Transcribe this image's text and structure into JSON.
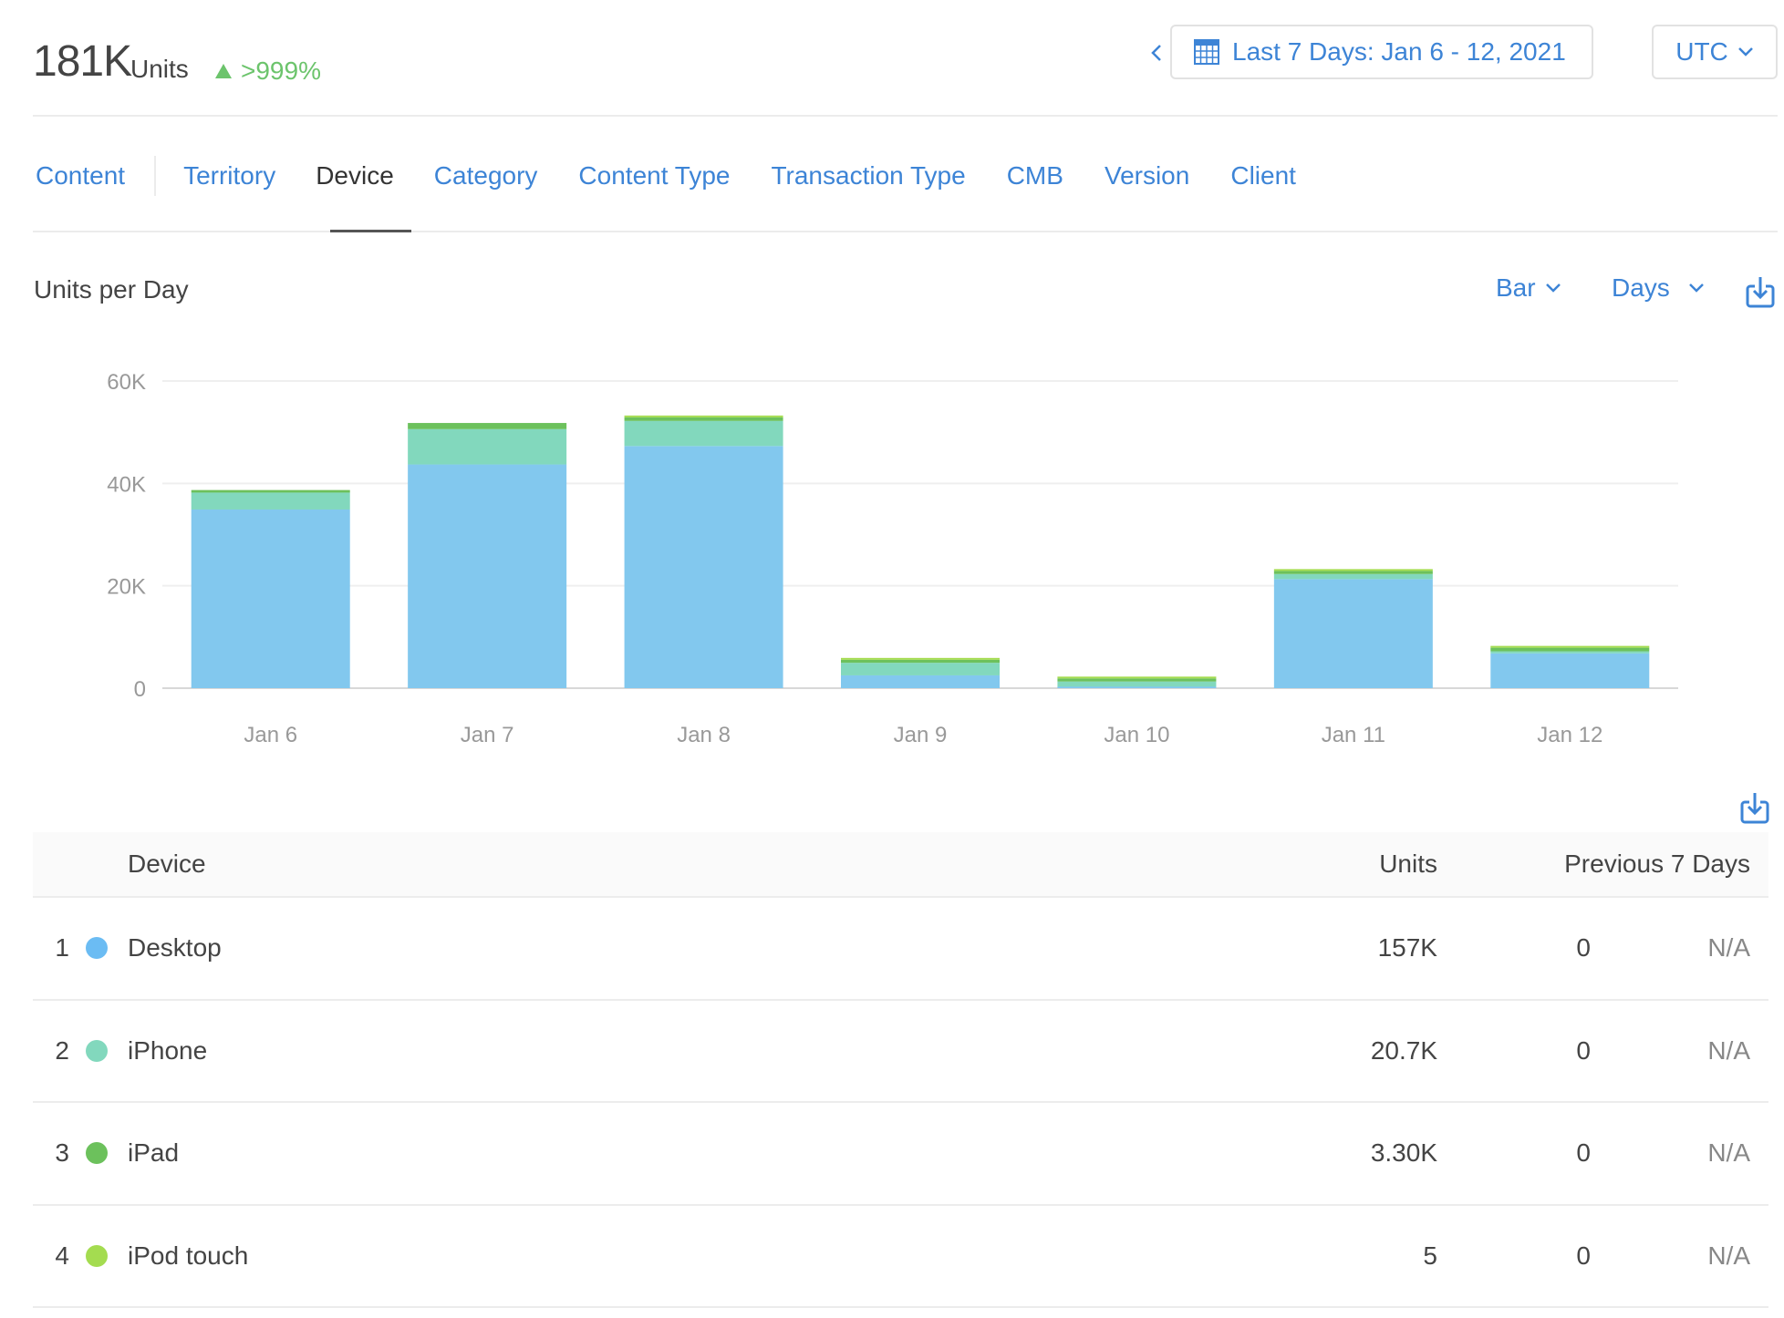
{
  "header": {
    "total_value": "181K",
    "total_unit": "Units",
    "change": ">999%",
    "change_direction": "up",
    "date_range": "Last 7 Days: Jan 6 - 12, 2021",
    "timezone": "UTC"
  },
  "tabs": [
    {
      "label": "Content",
      "active": false
    },
    {
      "label": "Territory",
      "active": false
    },
    {
      "label": "Device",
      "active": true
    },
    {
      "label": "Category",
      "active": false
    },
    {
      "label": "Content Type",
      "active": false
    },
    {
      "label": "Transaction Type",
      "active": false
    },
    {
      "label": "CMB",
      "active": false
    },
    {
      "label": "Version",
      "active": false
    },
    {
      "label": "Client",
      "active": false
    }
  ],
  "chart_controls": {
    "chart_type": "Bar",
    "period": "Days"
  },
  "colors": {
    "accent": "#3d84d6",
    "positive": "#6cc46c",
    "Desktop": "#82c8ee",
    "iPhone": "#82d8bd",
    "iPad": "#6cc15c",
    "iPod touch": "#a4dc50"
  },
  "chart_data": {
    "type": "bar",
    "stacked": true,
    "title": "Units per Day",
    "xlabel": "",
    "ylabel": "",
    "categories": [
      "Jan 6",
      "Jan 7",
      "Jan 8",
      "Jan 9",
      "Jan 10",
      "Jan 11",
      "Jan 12"
    ],
    "series": [
      {
        "name": "Desktop",
        "values": [
          34900,
          43700,
          47300,
          2500,
          300,
          21300,
          6800
        ]
      },
      {
        "name": "iPhone",
        "values": [
          3300,
          6900,
          4900,
          2450,
          1000,
          1000,
          400
        ]
      },
      {
        "name": "iPad",
        "values": [
          500,
          1200,
          700,
          600,
          600,
          600,
          700
        ]
      },
      {
        "name": "iPod touch",
        "values": [
          0,
          0,
          1,
          1,
          1,
          1,
          1
        ]
      }
    ],
    "yticks": [
      "0",
      "20K",
      "40K",
      "60K"
    ],
    "ytick_values": [
      0,
      20000,
      40000,
      60000
    ],
    "ylim": [
      0,
      60000
    ],
    "grid": true,
    "legend": "none"
  },
  "table": {
    "columns": [
      "Device",
      "Units",
      "Previous 7 Days"
    ],
    "rows": [
      {
        "rank": "1",
        "name": "Desktop",
        "units": "157K",
        "previous": "0",
        "change": "N/A"
      },
      {
        "rank": "2",
        "name": "iPhone",
        "units": "20.7K",
        "previous": "0",
        "change": "N/A"
      },
      {
        "rank": "3",
        "name": "iPad",
        "units": "3.30K",
        "previous": "0",
        "change": "N/A"
      },
      {
        "rank": "4",
        "name": "iPod touch",
        "units": "5",
        "previous": "0",
        "change": "N/A"
      }
    ]
  }
}
